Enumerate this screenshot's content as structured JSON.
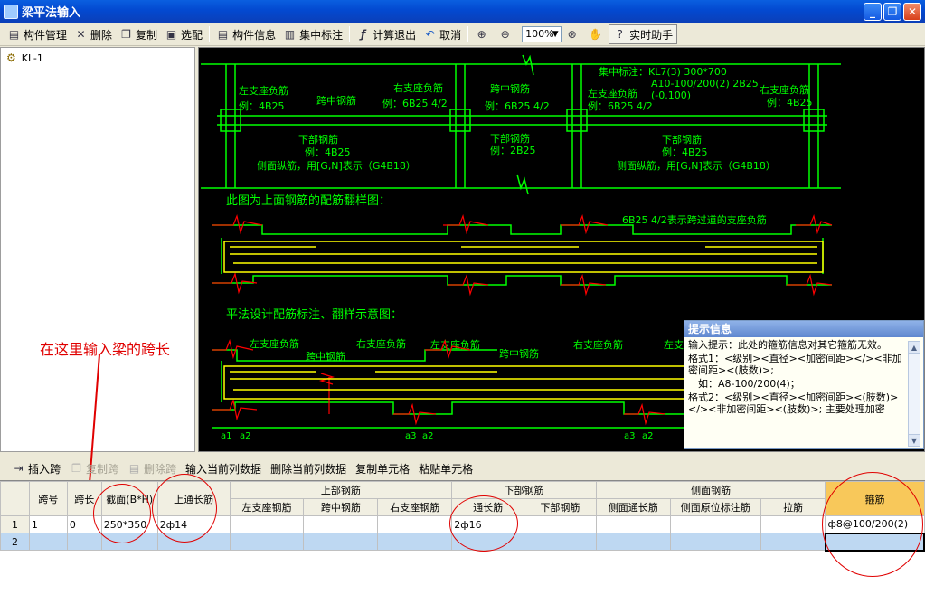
{
  "window": {
    "title": "梁平法输入",
    "min": "_",
    "max": "❐",
    "close": "✕"
  },
  "toolbar": {
    "items": [
      {
        "label": "构件管理",
        "icon": "component-manage-icon",
        "glyph": "▤"
      },
      {
        "label": "删除",
        "icon": "delete-icon",
        "glyph": "✕"
      },
      {
        "label": "复制",
        "icon": "copy-icon",
        "glyph": "❐"
      },
      {
        "label": "选配",
        "icon": "select-icon",
        "glyph": "▣"
      },
      {
        "label": "构件信息",
        "icon": "component-info-icon",
        "glyph": "▤"
      },
      {
        "label": "集中标注",
        "icon": "centralized-label-icon",
        "glyph": "▥"
      },
      {
        "label": "计算退出",
        "icon": "calculate-exit-icon",
        "glyph": "ƒ"
      },
      {
        "label": "取消",
        "icon": "undo-icon",
        "glyph": "↶"
      }
    ],
    "zoom": "100%",
    "helper": "实时助手"
  },
  "tree": {
    "node": "KL-1"
  },
  "cad": {
    "left_support": "左支座负筋",
    "mid_rebar": "跨中钢筋",
    "right_support": "右支座负筋",
    "bottom_rebar": "下部钢筋",
    "example_4b25": "例：4B25",
    "example_6b25": "例：6B25 4/2",
    "example_2b25": "例：2B25",
    "side_rebar": "侧面纵筋，用[G,N]表示（G4B18）",
    "central_1": "集中标注：KL7(3) 300*700",
    "central_2": "A10-100/200(2) 2B25",
    "central_3": "(-0.100)",
    "title_upper": "此图为上面钢筋的配筋翻样图：",
    "note_6b25": "6B25 4/2表示跨过道的支座负筋",
    "title_flat": "平法设计配筋标注、翻样示意图：",
    "a1": "a1",
    "a2": "a2",
    "a3": "a3"
  },
  "annotation": "在这里输入梁的跨长",
  "tip": {
    "header": "提示信息",
    "lines": [
      "输入提示：此处的箍筋信息对其它箍筋无效。",
      "格式1：<级别><直径><加密间距></><非加密间距><(肢数)>;",
      "　如：A8-100/200(4)；",
      "格式2：<级别><直径><加密间距><(肢数)></><非加密间距><(肢数)>; 主要处理加密"
    ],
    "up": "▲",
    "down": "▼"
  },
  "span_toolbar": {
    "insert": "插入跨",
    "copy": "复制跨",
    "delete": "删除跨",
    "input_current": "输入当前列数据",
    "delete_current": "删除当前列数据",
    "copy_cell": "复制单元格",
    "paste_cell": "粘贴单元格"
  },
  "grid": {
    "group_headers": {
      "upper": "上部钢筋",
      "lower": "下部钢筋",
      "side": "侧面钢筋"
    },
    "headers": {
      "span_no": "跨号",
      "span_len": "跨长",
      "section": "截面(B*H)",
      "top_through": "上通长筋",
      "left_support": "左支座钢筋",
      "mid": "跨中钢筋",
      "right_support": "右支座钢筋",
      "bottom_through": "通长筋",
      "bottom": "下部钢筋",
      "side_through": "侧面通长筋",
      "side_orig": "侧面原位标注筋",
      "tie": "拉筋",
      "stirrup": "箍筋"
    },
    "rows": [
      {
        "row": "1",
        "span_no": "1",
        "span_len": "0",
        "section": "250*350",
        "top_through": "2ф14",
        "left_support": "",
        "mid": "",
        "right_support": "",
        "bottom_through": "2ф16",
        "bottom": "",
        "side_through": "",
        "side_orig": "",
        "tie": "",
        "stirrup": "ф8@100/200(2)"
      },
      {
        "row": "2",
        "span_no": "",
        "span_len": "",
        "section": "",
        "top_through": "",
        "left_support": "",
        "mid": "",
        "right_support": "",
        "bottom_through": "",
        "bottom": "",
        "side_through": "",
        "side_orig": "",
        "tie": "",
        "stirrup": ""
      }
    ]
  },
  "colors": {
    "cad_green": "#00ff00",
    "cad_yellow": "#ffff00",
    "cad_red": "#ff0000",
    "cad_white": "#ffffff",
    "annotation_red": "#e00000",
    "stirrup_header": "#f8c85a",
    "selected_row": "#bed8f2"
  }
}
